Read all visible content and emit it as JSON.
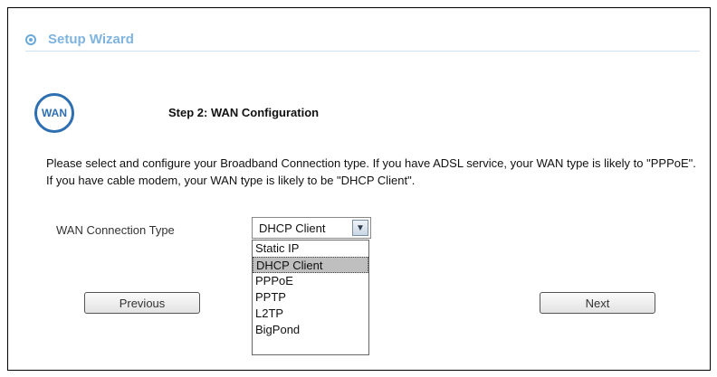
{
  "header": {
    "title": "Setup Wizard",
    "icon": "target-icon"
  },
  "step": {
    "badge_text": "WAN",
    "title": "Step 2: WAN Configuration"
  },
  "description": "Please select and configure your Broadband Connection type. If you have ADSL service, your WAN type is likely to \"PPPoE\". If you have cable modem, your WAN type is likely to be \"DHCP Client\".",
  "wan": {
    "label": "WAN Connection Type",
    "selected": "DHCP Client",
    "options": [
      "Static IP",
      "DHCP Client",
      "PPPoE",
      "PPTP",
      "L2TP",
      "BigPond"
    ]
  },
  "buttons": {
    "previous": "Previous",
    "next": "Next"
  },
  "colors": {
    "header_accent": "#7fb4df",
    "badge": "#2d6fb0",
    "selected_option_bg": "#bfbfbf"
  }
}
